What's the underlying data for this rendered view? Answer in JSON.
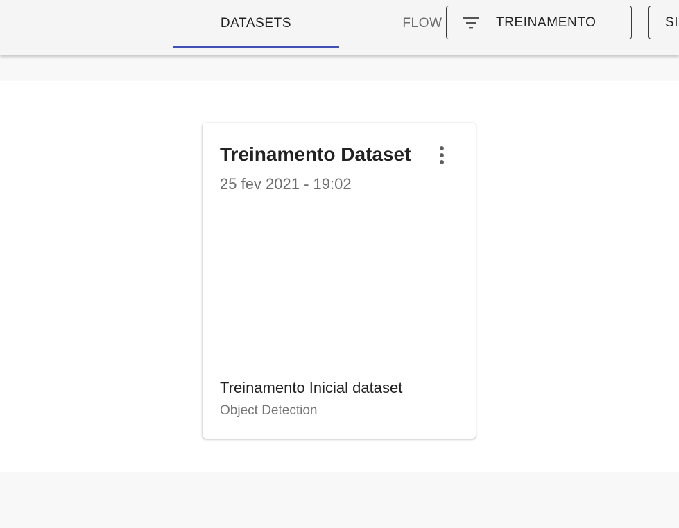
{
  "tabs": [
    {
      "label": "DATASETS",
      "active": true
    },
    {
      "label": "FLOW",
      "active": false
    }
  ],
  "toolbar": {
    "filter_button_label": "TREINAMENTO",
    "filter_icon": "filter-list-icon",
    "second_button_label": "SI"
  },
  "colors": {
    "accent": "#3f51b5"
  },
  "card": {
    "title": "Treinamento Dataset",
    "date": "25 fev 2021 - 19:02",
    "menu_icon": "more-vert-icon",
    "name": "Treinamento Inicial dataset",
    "type": "Object Detection"
  }
}
